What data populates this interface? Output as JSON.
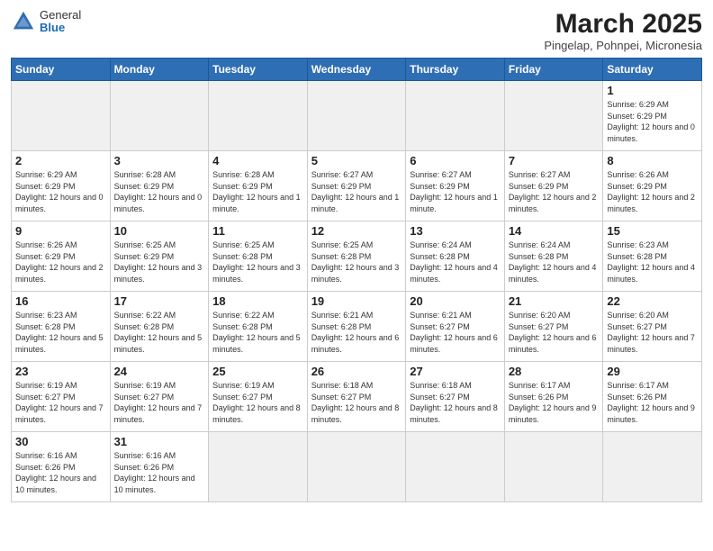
{
  "header": {
    "logo_general": "General",
    "logo_blue": "Blue",
    "month_title": "March 2025",
    "subtitle": "Pingelap, Pohnpei, Micronesia"
  },
  "weekdays": [
    "Sunday",
    "Monday",
    "Tuesday",
    "Wednesday",
    "Thursday",
    "Friday",
    "Saturday"
  ],
  "weeks": [
    [
      {
        "day": "",
        "empty": true
      },
      {
        "day": "",
        "empty": true
      },
      {
        "day": "",
        "empty": true
      },
      {
        "day": "",
        "empty": true
      },
      {
        "day": "",
        "empty": true
      },
      {
        "day": "",
        "empty": true
      },
      {
        "day": "1",
        "sunrise": "Sunrise: 6:29 AM",
        "sunset": "Sunset: 6:29 PM",
        "daylight": "Daylight: 12 hours and 0 minutes."
      }
    ],
    [
      {
        "day": "2",
        "sunrise": "Sunrise: 6:29 AM",
        "sunset": "Sunset: 6:29 PM",
        "daylight": "Daylight: 12 hours and 0 minutes."
      },
      {
        "day": "3",
        "sunrise": "Sunrise: 6:28 AM",
        "sunset": "Sunset: 6:29 PM",
        "daylight": "Daylight: 12 hours and 0 minutes."
      },
      {
        "day": "4",
        "sunrise": "Sunrise: 6:28 AM",
        "sunset": "Sunset: 6:29 PM",
        "daylight": "Daylight: 12 hours and 1 minute."
      },
      {
        "day": "5",
        "sunrise": "Sunrise: 6:27 AM",
        "sunset": "Sunset: 6:29 PM",
        "daylight": "Daylight: 12 hours and 1 minute."
      },
      {
        "day": "6",
        "sunrise": "Sunrise: 6:27 AM",
        "sunset": "Sunset: 6:29 PM",
        "daylight": "Daylight: 12 hours and 1 minute."
      },
      {
        "day": "7",
        "sunrise": "Sunrise: 6:27 AM",
        "sunset": "Sunset: 6:29 PM",
        "daylight": "Daylight: 12 hours and 2 minutes."
      },
      {
        "day": "8",
        "sunrise": "Sunrise: 6:26 AM",
        "sunset": "Sunset: 6:29 PM",
        "daylight": "Daylight: 12 hours and 2 minutes."
      }
    ],
    [
      {
        "day": "9",
        "sunrise": "Sunrise: 6:26 AM",
        "sunset": "Sunset: 6:29 PM",
        "daylight": "Daylight: 12 hours and 2 minutes."
      },
      {
        "day": "10",
        "sunrise": "Sunrise: 6:25 AM",
        "sunset": "Sunset: 6:29 PM",
        "daylight": "Daylight: 12 hours and 3 minutes."
      },
      {
        "day": "11",
        "sunrise": "Sunrise: 6:25 AM",
        "sunset": "Sunset: 6:28 PM",
        "daylight": "Daylight: 12 hours and 3 minutes."
      },
      {
        "day": "12",
        "sunrise": "Sunrise: 6:25 AM",
        "sunset": "Sunset: 6:28 PM",
        "daylight": "Daylight: 12 hours and 3 minutes."
      },
      {
        "day": "13",
        "sunrise": "Sunrise: 6:24 AM",
        "sunset": "Sunset: 6:28 PM",
        "daylight": "Daylight: 12 hours and 4 minutes."
      },
      {
        "day": "14",
        "sunrise": "Sunrise: 6:24 AM",
        "sunset": "Sunset: 6:28 PM",
        "daylight": "Daylight: 12 hours and 4 minutes."
      },
      {
        "day": "15",
        "sunrise": "Sunrise: 6:23 AM",
        "sunset": "Sunset: 6:28 PM",
        "daylight": "Daylight: 12 hours and 4 minutes."
      }
    ],
    [
      {
        "day": "16",
        "sunrise": "Sunrise: 6:23 AM",
        "sunset": "Sunset: 6:28 PM",
        "daylight": "Daylight: 12 hours and 5 minutes."
      },
      {
        "day": "17",
        "sunrise": "Sunrise: 6:22 AM",
        "sunset": "Sunset: 6:28 PM",
        "daylight": "Daylight: 12 hours and 5 minutes."
      },
      {
        "day": "18",
        "sunrise": "Sunrise: 6:22 AM",
        "sunset": "Sunset: 6:28 PM",
        "daylight": "Daylight: 12 hours and 5 minutes."
      },
      {
        "day": "19",
        "sunrise": "Sunrise: 6:21 AM",
        "sunset": "Sunset: 6:28 PM",
        "daylight": "Daylight: 12 hours and 6 minutes."
      },
      {
        "day": "20",
        "sunrise": "Sunrise: 6:21 AM",
        "sunset": "Sunset: 6:27 PM",
        "daylight": "Daylight: 12 hours and 6 minutes."
      },
      {
        "day": "21",
        "sunrise": "Sunrise: 6:20 AM",
        "sunset": "Sunset: 6:27 PM",
        "daylight": "Daylight: 12 hours and 6 minutes."
      },
      {
        "day": "22",
        "sunrise": "Sunrise: 6:20 AM",
        "sunset": "Sunset: 6:27 PM",
        "daylight": "Daylight: 12 hours and 7 minutes."
      }
    ],
    [
      {
        "day": "23",
        "sunrise": "Sunrise: 6:19 AM",
        "sunset": "Sunset: 6:27 PM",
        "daylight": "Daylight: 12 hours and 7 minutes."
      },
      {
        "day": "24",
        "sunrise": "Sunrise: 6:19 AM",
        "sunset": "Sunset: 6:27 PM",
        "daylight": "Daylight: 12 hours and 7 minutes."
      },
      {
        "day": "25",
        "sunrise": "Sunrise: 6:19 AM",
        "sunset": "Sunset: 6:27 PM",
        "daylight": "Daylight: 12 hours and 8 minutes."
      },
      {
        "day": "26",
        "sunrise": "Sunrise: 6:18 AM",
        "sunset": "Sunset: 6:27 PM",
        "daylight": "Daylight: 12 hours and 8 minutes."
      },
      {
        "day": "27",
        "sunrise": "Sunrise: 6:18 AM",
        "sunset": "Sunset: 6:27 PM",
        "daylight": "Daylight: 12 hours and 8 minutes."
      },
      {
        "day": "28",
        "sunrise": "Sunrise: 6:17 AM",
        "sunset": "Sunset: 6:26 PM",
        "daylight": "Daylight: 12 hours and 9 minutes."
      },
      {
        "day": "29",
        "sunrise": "Sunrise: 6:17 AM",
        "sunset": "Sunset: 6:26 PM",
        "daylight": "Daylight: 12 hours and 9 minutes."
      }
    ],
    [
      {
        "day": "30",
        "sunrise": "Sunrise: 6:16 AM",
        "sunset": "Sunset: 6:26 PM",
        "daylight": "Daylight: 12 hours and 10 minutes."
      },
      {
        "day": "31",
        "sunrise": "Sunrise: 6:16 AM",
        "sunset": "Sunset: 6:26 PM",
        "daylight": "Daylight: 12 hours and 10 minutes."
      },
      {
        "day": "",
        "empty": true
      },
      {
        "day": "",
        "empty": true
      },
      {
        "day": "",
        "empty": true
      },
      {
        "day": "",
        "empty": true
      },
      {
        "day": "",
        "empty": true
      }
    ]
  ]
}
